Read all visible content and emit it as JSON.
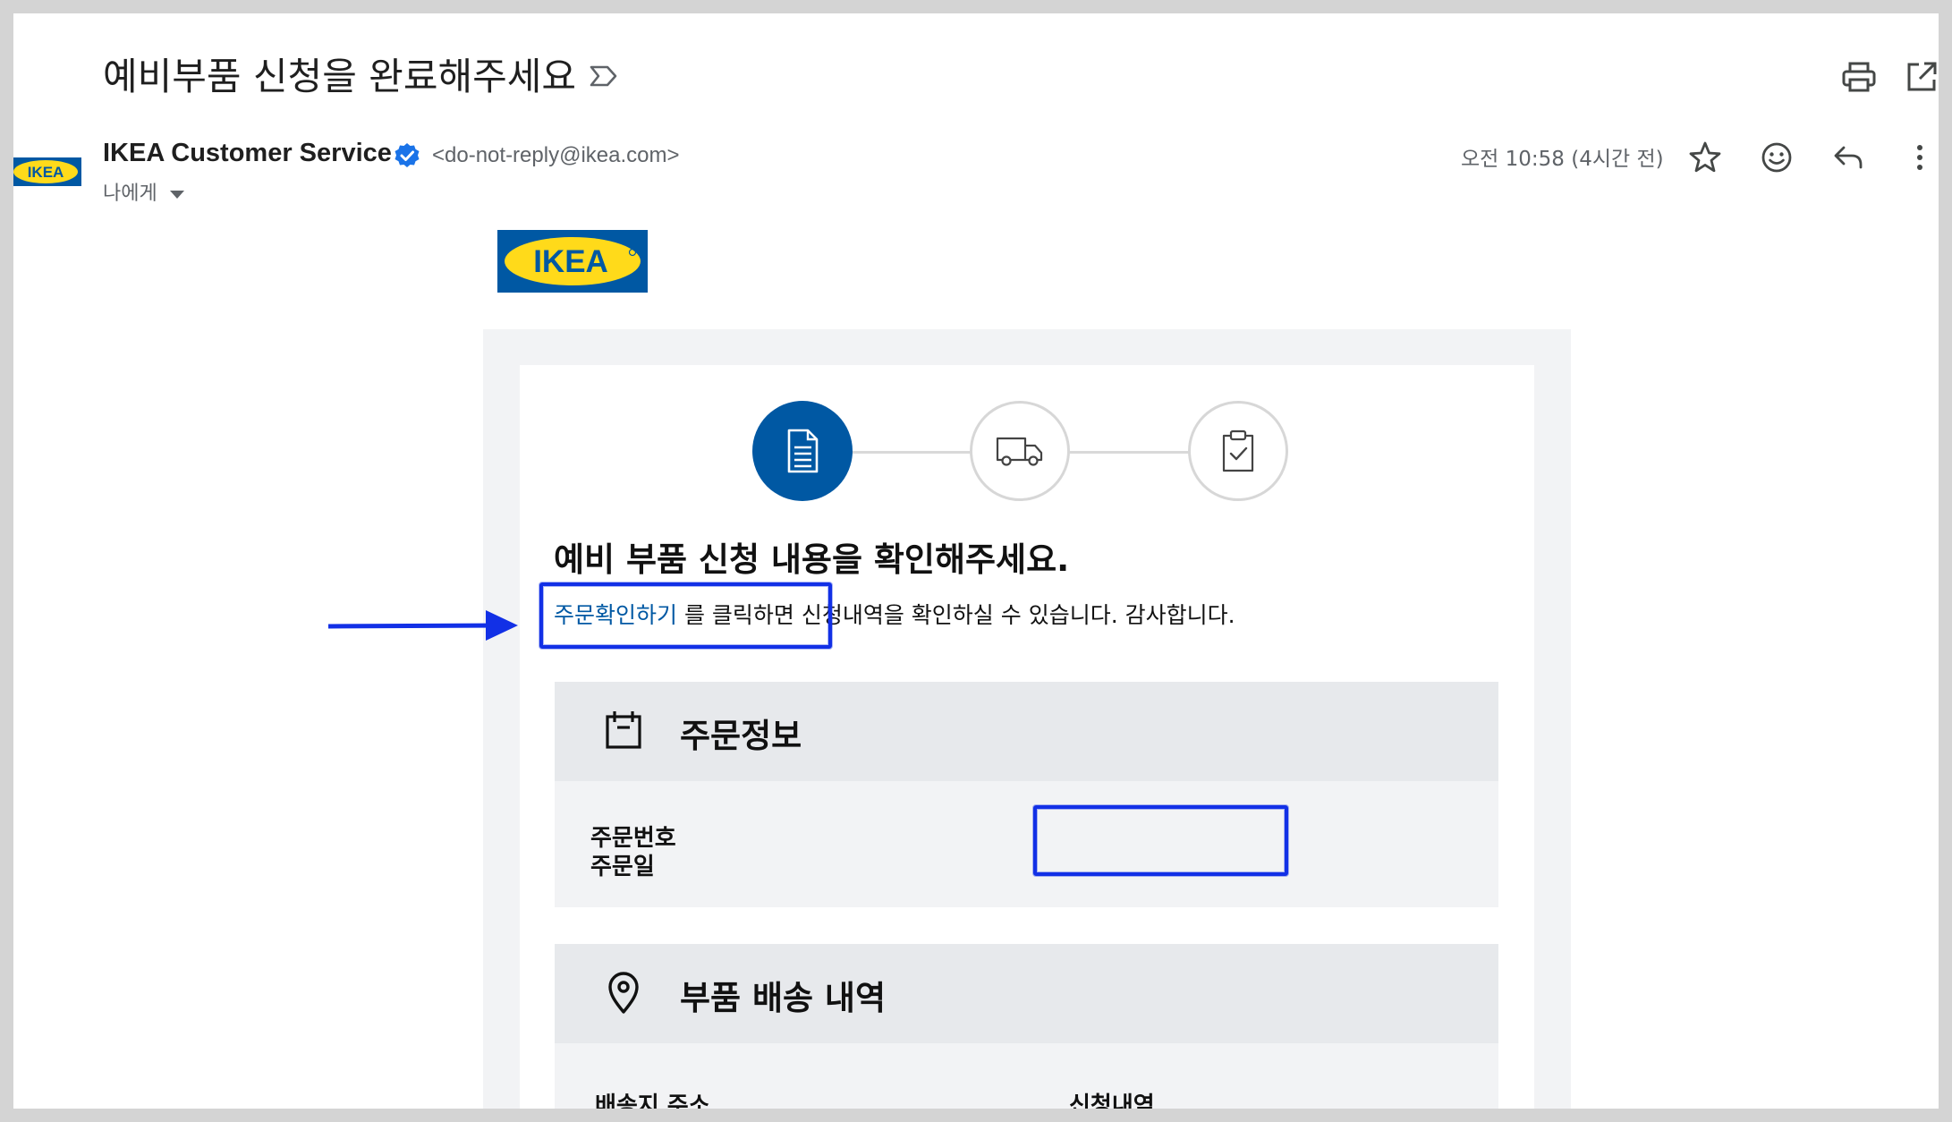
{
  "email": {
    "subject": "예비부품 신청을 완료해주세요",
    "sender_name": "IKEA Customer Service",
    "sender_email": "<do-not-reply@ikea.com>",
    "recipient": "나에게",
    "time": "오전 10:58 (4시간 전)",
    "sender_logo_text": "IKEA"
  },
  "colors": {
    "ikea_blue": "#0058a3",
    "ikea_yellow": "#ffda1a",
    "annotation_blue": "#1230e6"
  },
  "body": {
    "logo_text": "IKEA",
    "steps": [
      {
        "icon": "document-icon",
        "state": "active"
      },
      {
        "icon": "truck-icon",
        "state": "inactive"
      },
      {
        "icon": "clipboard-check-icon",
        "state": "inactive"
      }
    ],
    "headline": "예비 부품 신청 내용을 확인해주세요.",
    "desc_link": "주문확인하기",
    "desc_rest": " 를 클릭하면 신청내역을 확인하실 수 있습니다. 감사합니다.",
    "order_section": {
      "title": "주문정보",
      "label_order_number": "주문번호",
      "label_order_date": "주문일"
    },
    "delivery_section": {
      "title": "부품 배송 내역",
      "label_address": "배송지 주소",
      "label_request": "신청내역"
    }
  }
}
